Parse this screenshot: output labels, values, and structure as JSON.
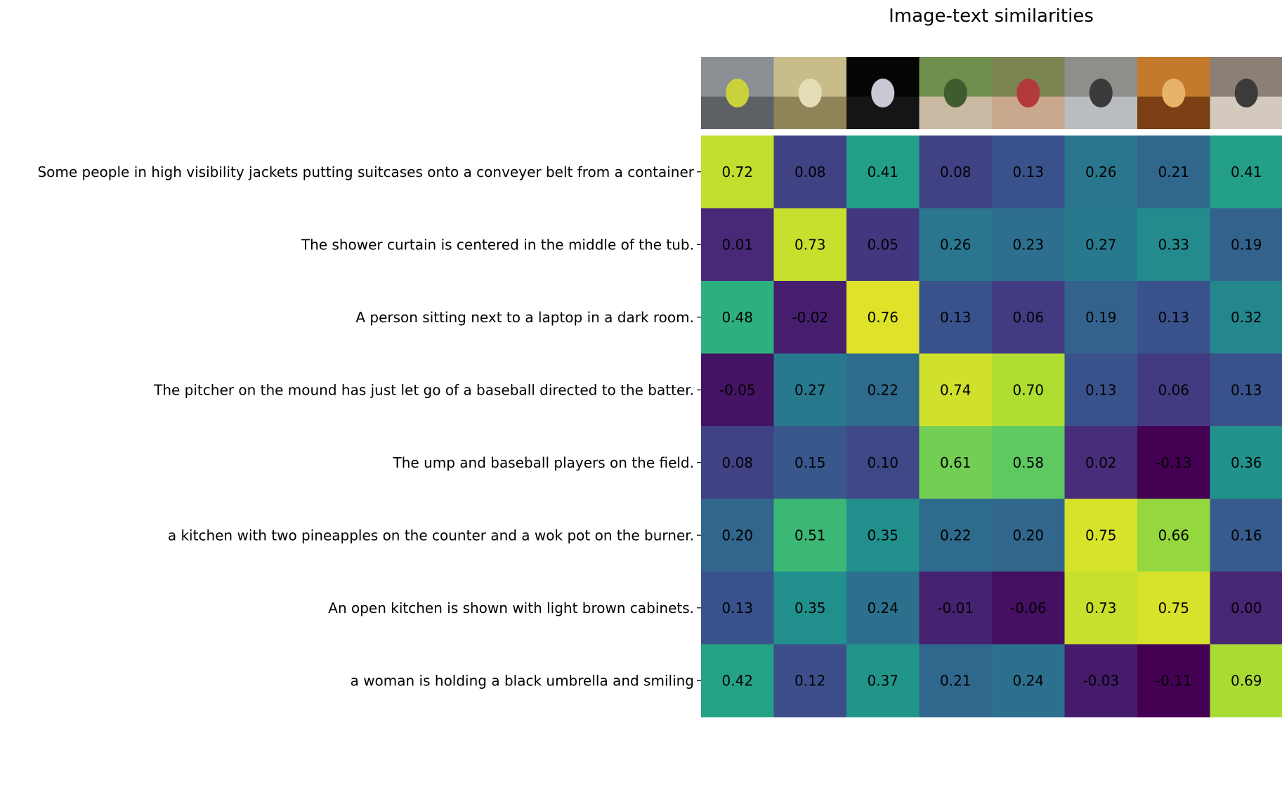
{
  "chart_data": {
    "type": "heatmap",
    "title": "Image-text similarities",
    "image_header": [
      "container unloading scene",
      "bathroom with shower curtain",
      "person with laptop in dark room",
      "baseball field",
      "baseball pitcher",
      "modern kitchen",
      "wooden kitchen cabinets",
      "woman with umbrella"
    ],
    "rows": [
      "Some people in high visibility jackets putting suitcases onto a conveyer belt from a container",
      "The shower curtain is centered in the middle of the tub.",
      "A person sitting next to a laptop in a dark room.",
      "The pitcher  on the mound has just let go of a baseball directed to the batter. ",
      "The ump and baseball players on the field.",
      "a kitchen with two pineapples on the counter and a wok pot on the burner.",
      "An open kitchen is shown with light brown cabinets.",
      "a woman is holding a black umbrella and smiling"
    ],
    "values": [
      [
        0.72,
        0.08,
        0.41,
        0.08,
        0.13,
        0.26,
        0.21,
        0.41
      ],
      [
        0.01,
        0.73,
        0.05,
        0.26,
        0.23,
        0.27,
        0.33,
        0.19
      ],
      [
        0.48,
        -0.02,
        0.76,
        0.13,
        0.06,
        0.19,
        0.13,
        0.32
      ],
      [
        -0.05,
        0.27,
        0.22,
        0.74,
        0.7,
        0.13,
        0.06,
        0.13
      ],
      [
        0.08,
        0.15,
        0.1,
        0.61,
        0.58,
        0.02,
        -0.13,
        0.36
      ],
      [
        0.2,
        0.51,
        0.35,
        0.22,
        0.2,
        0.75,
        0.66,
        0.16
      ],
      [
        0.13,
        0.35,
        0.24,
        -0.01,
        -0.06,
        0.73,
        0.75,
        -0.0
      ],
      [
        0.42,
        0.12,
        0.37,
        0.21,
        0.24,
        -0.03,
        -0.11,
        0.69
      ]
    ],
    "colormap": "viridis",
    "value_range": [
      -0.1,
      0.8
    ],
    "value_format": "2 decimals"
  }
}
